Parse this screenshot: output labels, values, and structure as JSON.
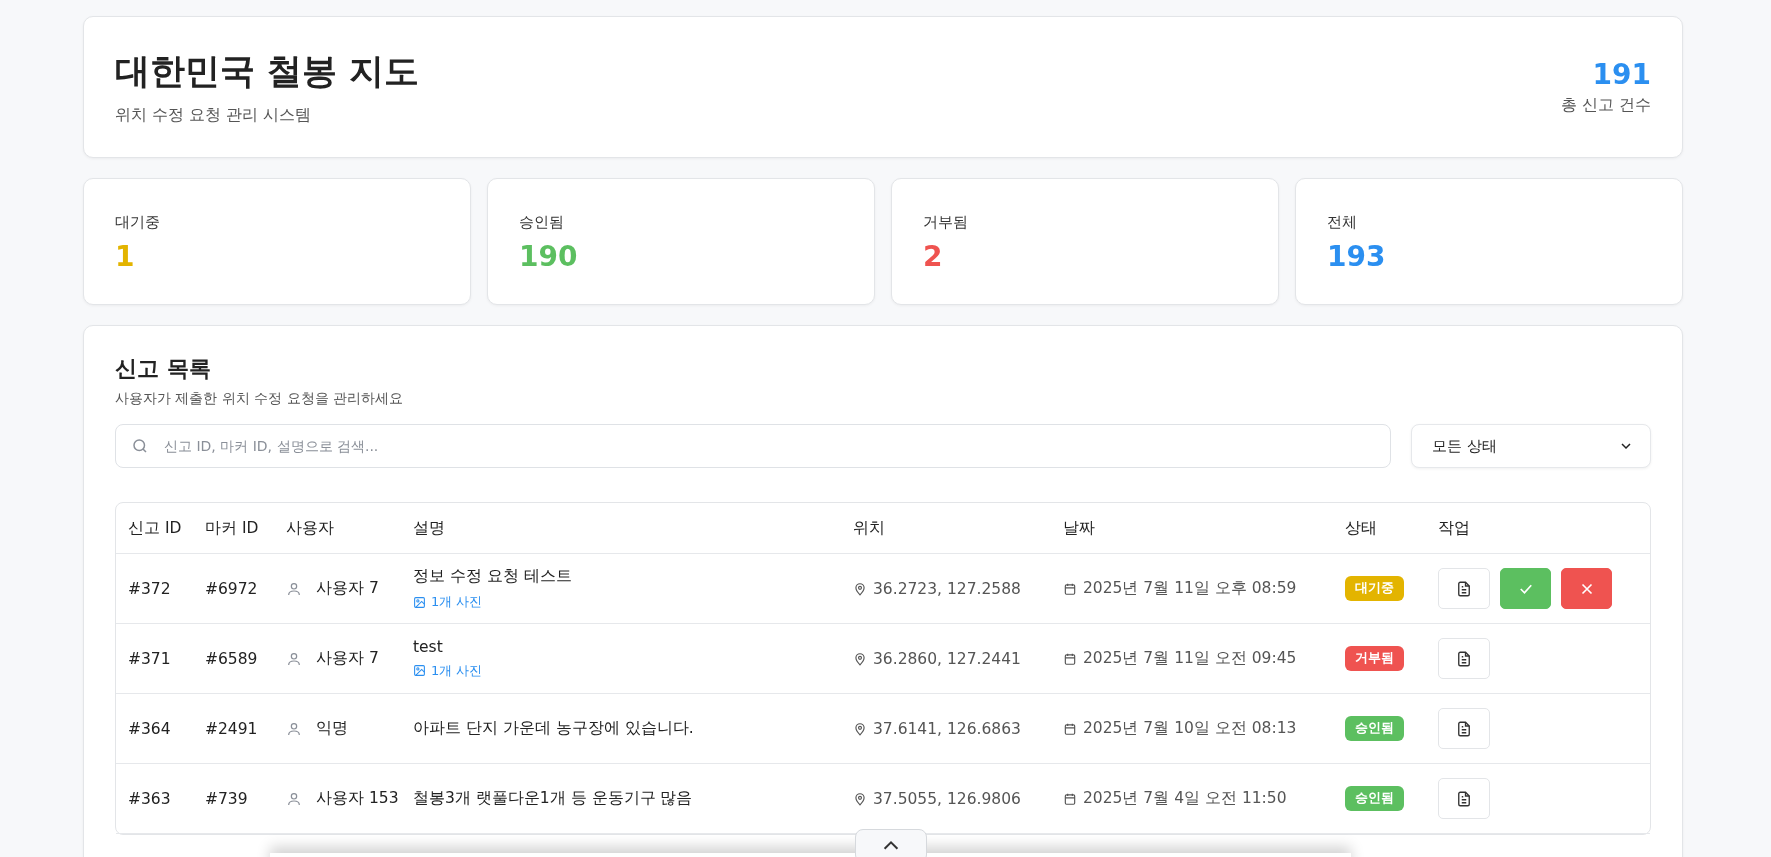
{
  "header": {
    "title": "대한민국 철봉 지도",
    "subtitle": "위치 수정 요청 관리 시스템",
    "total": "191",
    "total_label": "총 신고 건수"
  },
  "stats": [
    {
      "label": "대기중",
      "value": "1",
      "color": "#e3b400"
    },
    {
      "label": "승인됨",
      "value": "190",
      "color": "#5cbf60"
    },
    {
      "label": "거부됨",
      "value": "2",
      "color": "#ef5350"
    },
    {
      "label": "전체",
      "value": "193",
      "color": "#2b8ff0"
    }
  ],
  "list": {
    "title": "신고 목록",
    "subtitle": "사용자가 제출한 위치 수정 요청을 관리하세요",
    "search": {
      "placeholder": "신고 ID, 마커 ID, 설명으로 검색..."
    },
    "filter": "모든 상태"
  },
  "table": {
    "columns": [
      "신고 ID",
      "마커 ID",
      "사용자",
      "설명",
      "위치",
      "날짜",
      "상태",
      "작업"
    ],
    "rows": [
      {
        "id": "#372",
        "marker": "#6972",
        "user": "사용자 7",
        "description": "정보 수정 요청 테스트",
        "photos": "1개 사진",
        "location": "36.2723, 127.2588",
        "date": "2025년 7월 11일 오후 08:59",
        "status": {
          "kind": "pending",
          "label": "대기중"
        },
        "actions": [
          {
            "kind": "view"
          },
          {
            "kind": "approve"
          },
          {
            "kind": "reject"
          }
        ]
      },
      {
        "id": "#371",
        "marker": "#6589",
        "user": "사용자 7",
        "description": "test",
        "photos": "1개 사진",
        "location": "36.2860, 127.2441",
        "date": "2025년 7월 11일 오전 09:45",
        "status": {
          "kind": "rejected",
          "label": "거부됨"
        },
        "actions": [
          {
            "kind": "view"
          }
        ]
      },
      {
        "id": "#364",
        "marker": "#2491",
        "user": "익명",
        "description": "아파트 단지 가운데 농구장에 있습니다.",
        "location": "37.6141, 126.6863",
        "date": "2025년 7월 10일 오전 08:13",
        "status": {
          "kind": "approved",
          "label": "승인됨"
        },
        "actions": [
          {
            "kind": "view"
          }
        ]
      },
      {
        "id": "#363",
        "marker": "#739",
        "user": "사용자 153",
        "description": "철봉3개 랫풀다운1개 등 운동기구 많음",
        "location": "37.5055, 126.9806",
        "date": "2025년 7월 4일 오전 11:50",
        "status": {
          "kind": "approved",
          "label": "승인됨"
        },
        "actions": [
          {
            "kind": "view"
          }
        ]
      }
    ]
  }
}
